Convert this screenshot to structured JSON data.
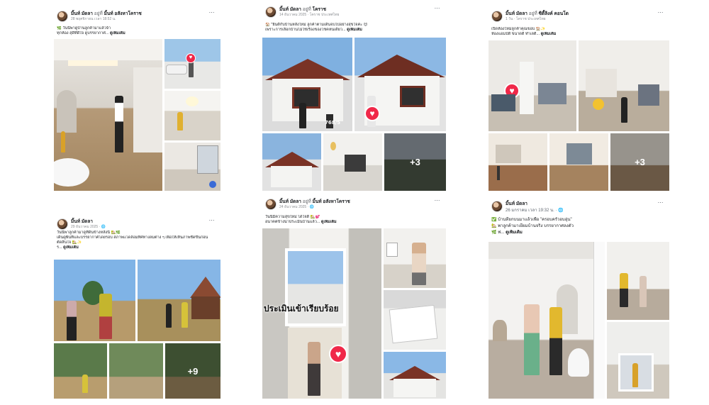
{
  "posts": [
    {
      "author": "มิ้นท์ มัดลา",
      "at_word": "อยู่ที่",
      "place": "มิ้นท์ อสังหาโคราช",
      "date": "28 พฤศจิกายน เวลา 18:52 น.",
      "lines": [
        "🌿 วันนี้พาดูบ้านลูกค้ามาแล้วจ้า",
        "ทุกห้อง สุดีที่ดีใจ ดูบรรยากาศ... "
      ],
      "see_more": "ดูเพิ่มเติม",
      "extra_count": ""
    },
    {
      "author": "มิ้นท์ มัดลา",
      "at_word": "อยู่ที่",
      "place": "โคราช",
      "date": "14 ธันวาคม 2025 · โคราช ประเทศไทย",
      "lines": [
        "🏠 \"ยินดีกับบ้านหลังใหม่ ลูกค้าตามเดินจบไปอย่างสุขใจค่ะ 😊",
        "เพราะการเลือกบ้านไม่ใช่เรื่องของโชคหนเดียว... "
      ],
      "see_more": "ดูเพิ่มเติม",
      "extra_count": "+3",
      "plate": "768/5"
    },
    {
      "author": "มิ้นท์ มัดลา",
      "at_word": "อยู่ที่",
      "place": "ซิตี้ลิงค์ คอนโด",
      "date": "1 วัน · โคราช ประเทศไทย",
      "lines": [
        "เปิดห้องใหม่ลูกค้าคุณขอบ 🏠✨",
        "ห้องแอมบ์ดี ขนาดดี ทำเลดี... "
      ],
      "see_more": "ดูเพิ่มเติม",
      "extra_count": "+3"
    },
    {
      "author": "มิ้นท์ มัดลา",
      "at_word": "",
      "place": "",
      "date": "29 ธันวาคม 2025 · 🌐",
      "lines": [
        "วันนี้พาลูกค้ามาดูที่ดินข้างหลังนี้ 🏡🌿",
        "เดินดูพื้นที่และบรรยากาศโดยรอบ สภาพแวดล้อมทิศทางลมต่าง ๆ เพื่อให้เห็นภาพชัดขึ้นก่อน",
        "ตัดสินใจ 🏡✨",
        "ร... "
      ],
      "see_more": "ดูเพิ่มเติม",
      "extra_count": "+9"
    },
    {
      "author": "มิ้นท์ มัดลา",
      "at_word": "อยู่ที่",
      "place": "มิ้นท์ อสังหาโคราช",
      "date": "24 ธันวาคม 2025 · 🌐",
      "lines": [
        "วันนี้มีความสุขใหม่ ได้ใจดี 🏡💕",
        "อนาคตข้างน่าประเมินบ้านแล้ว... "
      ],
      "see_more": "ดูเพิ่มเติม",
      "overlay": "ประเมินเข้าเรียบร้อย",
      "extra_count": ""
    },
    {
      "author": "มิ้นท์ มัดลา",
      "at_word": "",
      "place": "",
      "date": "26 มกราคม เวลา 19:32 น. · 🌐",
      "lines": [
        "✅ บ้านที่ยกบนมาแล้วเพื่อ \"ครอบครัวอบอุ่น\"",
        "🏡 พาลูกค้ามาเยี่ยมบ้านจริง บรรยากาศลงตัว",
        "🌿 ฟ... "
      ],
      "see_more": "ดูเพิ่มเติม",
      "extra_count": ""
    }
  ],
  "more_icon": "⋯",
  "heart_icon": "♥"
}
